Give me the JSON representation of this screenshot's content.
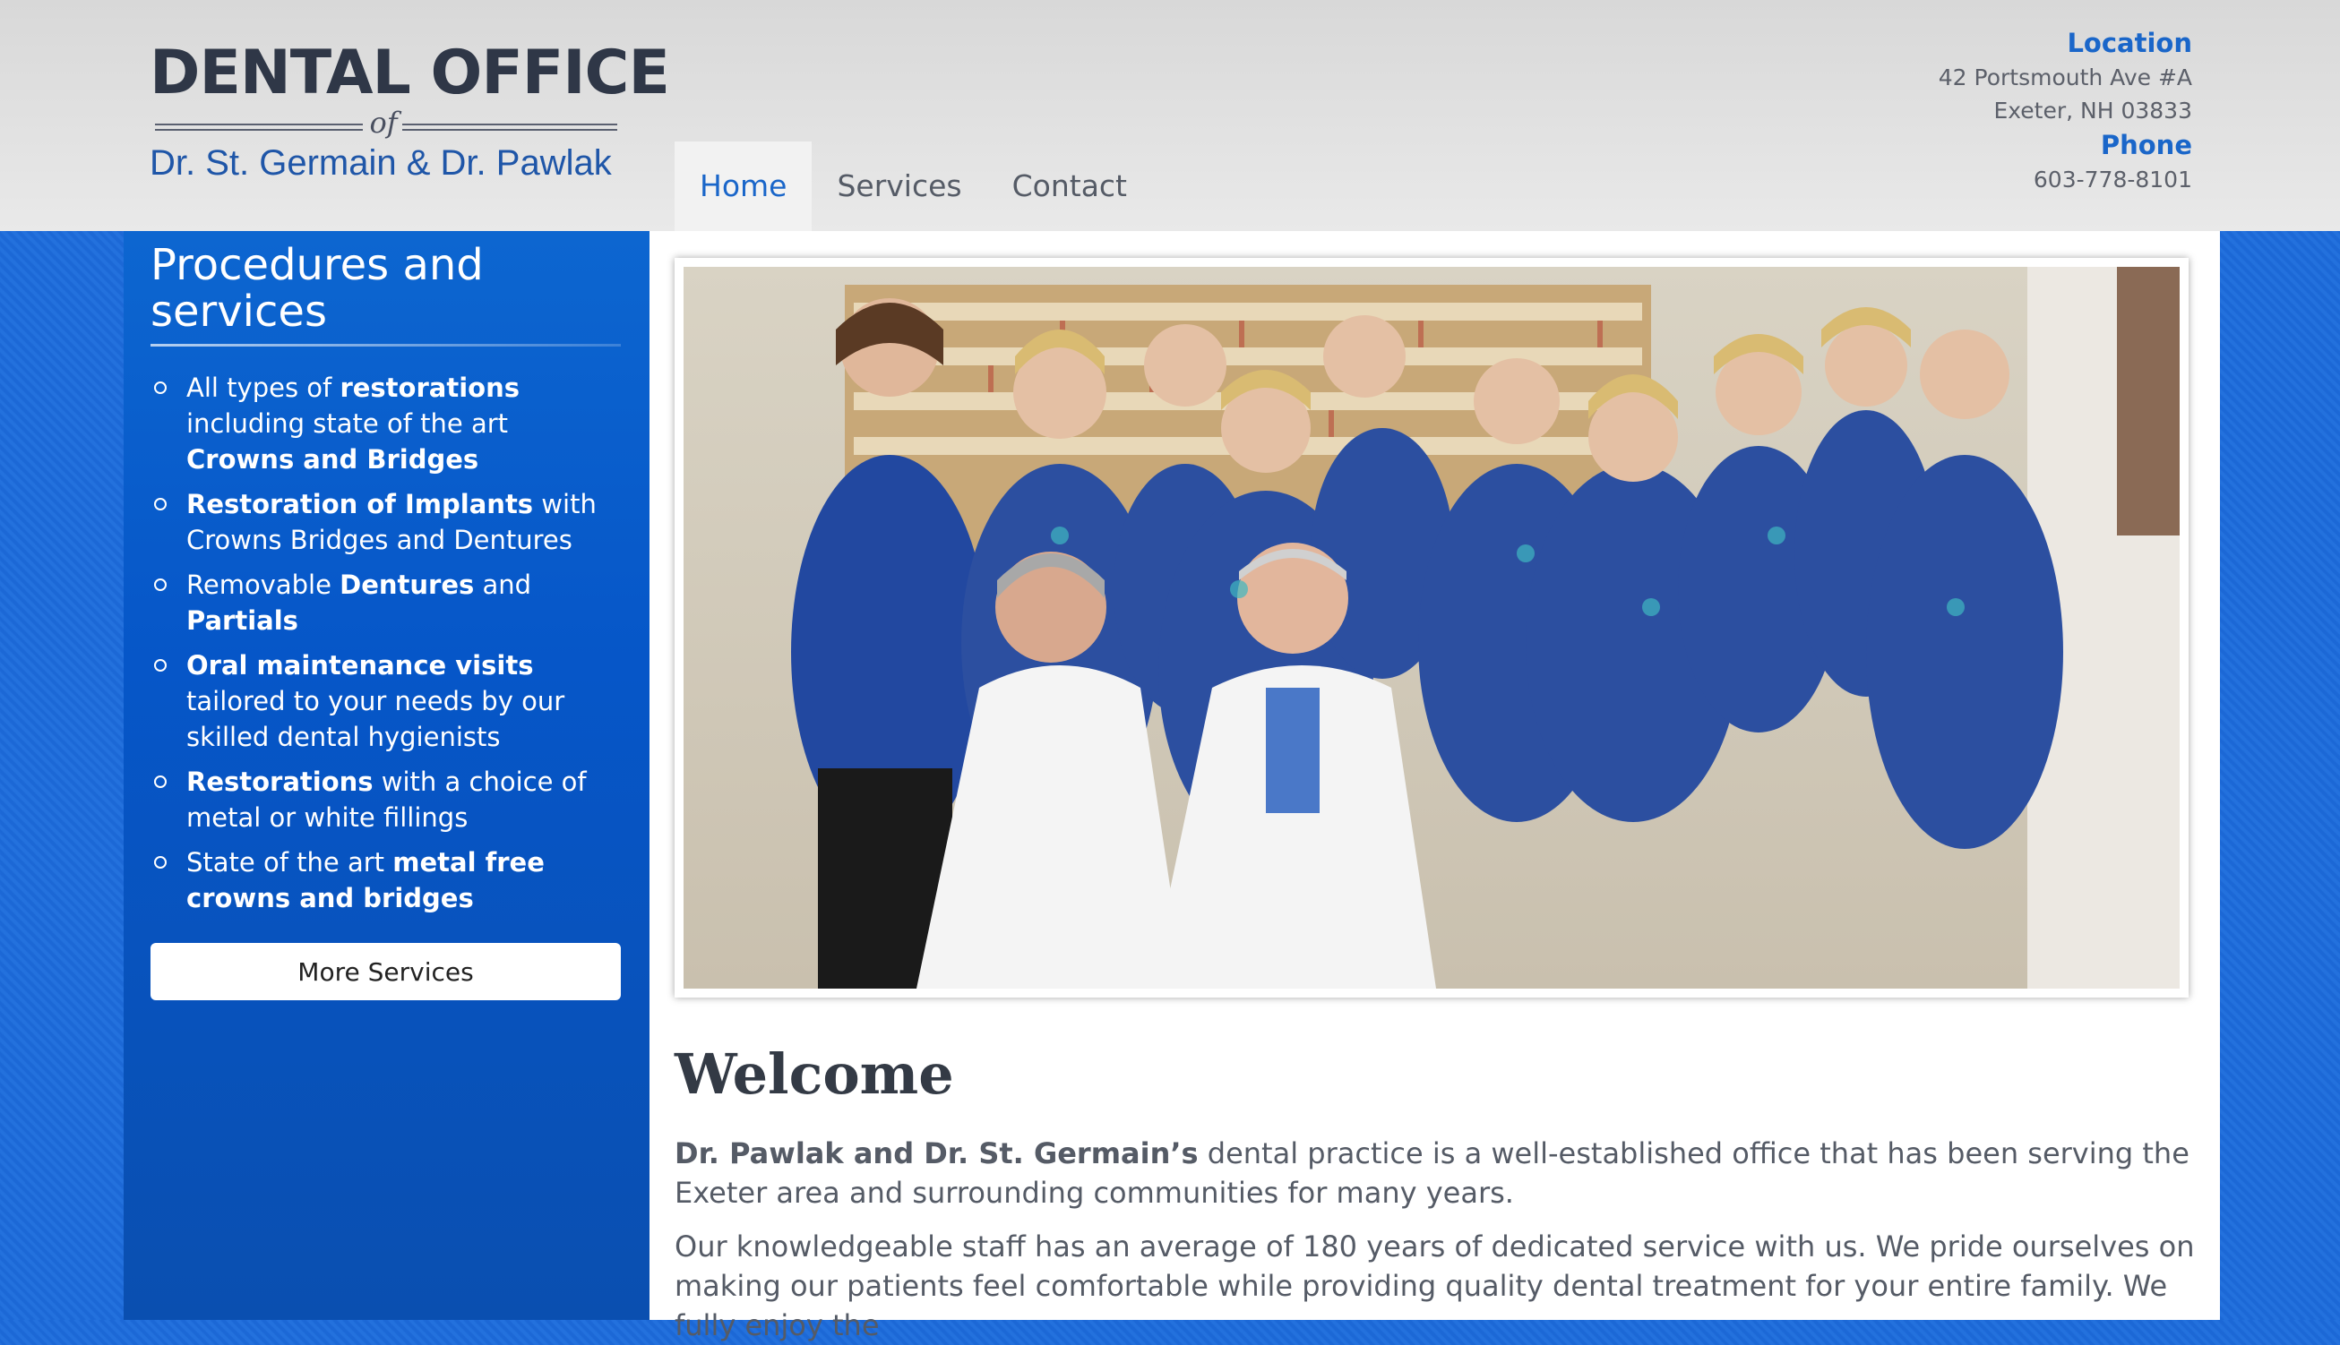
{
  "logo": {
    "title": "DENTAL OFFICE",
    "of": "of",
    "subtitle": "Dr. St. Germain & Dr. Pawlak"
  },
  "nav": {
    "tabs": [
      {
        "label": "Home",
        "active": true
      },
      {
        "label": "Services",
        "active": false
      },
      {
        "label": "Contact",
        "active": false
      }
    ]
  },
  "contact": {
    "location_label": "Location",
    "address_line1": "42 Portsmouth Ave #A",
    "address_line2": "Exeter, NH 03833",
    "phone_label": "Phone",
    "phone": "603-778-8101"
  },
  "sidebar": {
    "title": "Procedures and services",
    "items": [
      {
        "parts": [
          [
            "All types of ",
            false
          ],
          [
            "restorations",
            true
          ],
          [
            " including state of the art ",
            false
          ],
          [
            "Crowns and Bridges",
            true
          ]
        ]
      },
      {
        "parts": [
          [
            "Restoration of Implants",
            true
          ],
          [
            " with Crowns Bridges and Dentures",
            false
          ]
        ]
      },
      {
        "parts": [
          [
            "Removable ",
            false
          ],
          [
            "Dentures",
            true
          ],
          [
            " and ",
            false
          ],
          [
            "Partials",
            true
          ]
        ]
      },
      {
        "parts": [
          [
            "Oral maintenance visits",
            true
          ],
          [
            " tailored to your needs by our skilled dental hygienists",
            false
          ]
        ]
      },
      {
        "parts": [
          [
            "Restorations",
            true
          ],
          [
            " with a choice of metal or white fillings",
            false
          ]
        ]
      },
      {
        "parts": [
          [
            "State of the art ",
            false
          ],
          [
            "metal free crowns and bridges",
            true
          ]
        ]
      }
    ],
    "more_button": "More Services"
  },
  "main": {
    "welcome": "Welcome",
    "para1_bold": "Dr. Pawlak and Dr. St. Germain’s",
    "para1_rest": " dental practice is a well-established office that has been serving the Exeter area and surrounding communities for many years.",
    "para2": "Our knowledgeable staff has an average of 180 years of dedicated service with us. We pride ourselves on making our patients feel comfortable while providing quality dental treatment for your entire family. We fully enjoy the"
  },
  "colors": {
    "accent": "#1a66c9",
    "sidebar": "#0656c8",
    "background": "#1c68d6"
  }
}
